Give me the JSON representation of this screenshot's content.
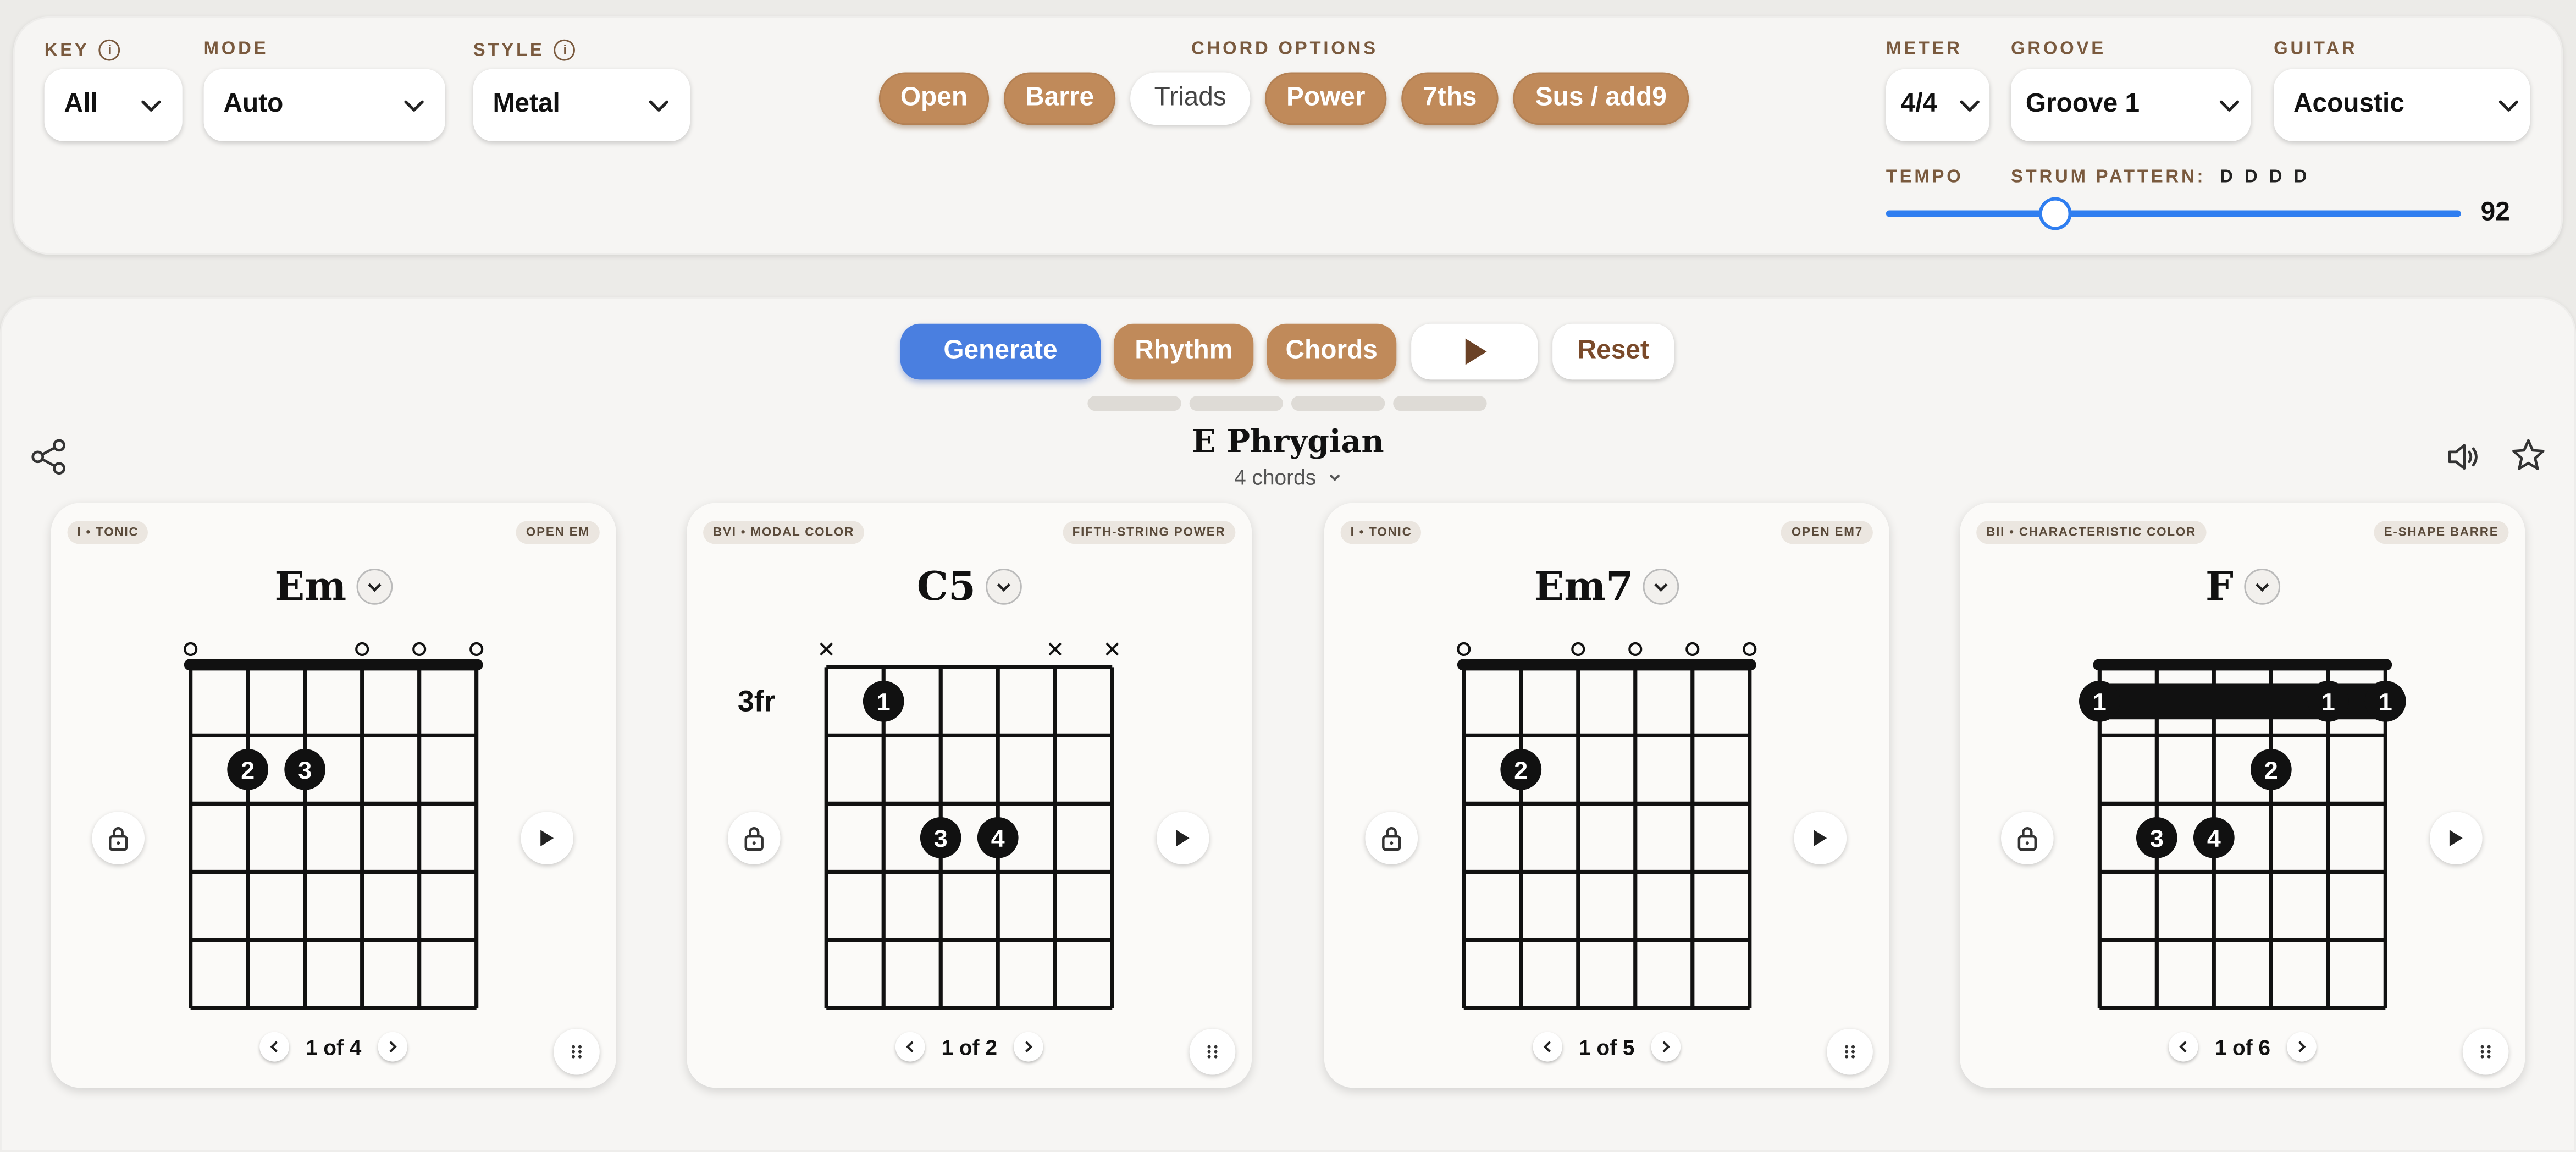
{
  "controls": {
    "key": {
      "label": "KEY",
      "value": "All"
    },
    "mode": {
      "label": "MODE",
      "value": "Auto"
    },
    "style": {
      "label": "STYLE",
      "value": "Metal"
    },
    "chord_options": {
      "label": "CHORD OPTIONS",
      "items": [
        {
          "label": "Open",
          "active": true
        },
        {
          "label": "Barre",
          "active": true
        },
        {
          "label": "Triads",
          "active": false
        },
        {
          "label": "Power",
          "active": true
        },
        {
          "label": "7ths",
          "active": true
        },
        {
          "label": "Sus / add9",
          "active": true
        }
      ]
    },
    "meter": {
      "label": "METER",
      "value": "4/4"
    },
    "groove": {
      "label": "GROOVE",
      "value": "Groove 1"
    },
    "guitar": {
      "label": "GUITAR",
      "value": "Acoustic"
    },
    "tempo": {
      "label": "TEMPO",
      "value": "92",
      "min": 40,
      "max": 220
    },
    "strum": {
      "label": "STRUM PATTERN:",
      "value": "D D D D"
    }
  },
  "actions": {
    "generate": "Generate",
    "rhythm": "Rhythm",
    "chords": "Chords",
    "reset": "Reset",
    "play_icon": "play-icon"
  },
  "progression": {
    "title": "E Phrygian",
    "count": "4 chords"
  },
  "colors": {
    "accent": "#c08a5a",
    "primary": "#4a7fe0",
    "label": "#7a5a3e",
    "background": "#ecebe8"
  },
  "chords": [
    {
      "role": "I • TONIC",
      "shape": "OPEN EM",
      "name": "Em",
      "page": "1 of 4",
      "markers": [
        "o",
        "",
        "",
        "o",
        "o",
        "o"
      ],
      "position": "",
      "nut": true,
      "barres": [],
      "dots": [
        {
          "string": 2,
          "fret": 2,
          "finger": "2"
        },
        {
          "string": 3,
          "fret": 2,
          "finger": "3"
        }
      ]
    },
    {
      "role": "BVI • MODAL COLOR",
      "shape": "FIFTH-STRING POWER",
      "name": "C5",
      "page": "1 of 2",
      "markers": [
        "x",
        "",
        "",
        "",
        "x",
        "x"
      ],
      "position": "3fr",
      "nut": false,
      "barres": [],
      "dots": [
        {
          "string": 2,
          "fret": 1,
          "finger": "1"
        },
        {
          "string": 3,
          "fret": 3,
          "finger": "3"
        },
        {
          "string": 4,
          "fret": 3,
          "finger": "4"
        }
      ]
    },
    {
      "role": "I • TONIC",
      "shape": "OPEN EM7",
      "name": "Em7",
      "page": "1 of 5",
      "markers": [
        "o",
        "",
        "o",
        "o",
        "o",
        "o"
      ],
      "position": "",
      "nut": true,
      "barres": [],
      "dots": [
        {
          "string": 2,
          "fret": 2,
          "finger": "2"
        }
      ]
    },
    {
      "role": "BII • CHARACTERISTIC COLOR",
      "shape": "E-SHAPE BARRE",
      "name": "F",
      "page": "1 of 6",
      "markers": [
        "",
        "",
        "",
        "",
        "",
        ""
      ],
      "position": "",
      "nut": true,
      "barres": [
        {
          "fret": 1,
          "from": 1,
          "to": 6
        }
      ],
      "dots": [
        {
          "string": 1,
          "fret": 1,
          "finger": "1"
        },
        {
          "string": 5,
          "fret": 1,
          "finger": "1"
        },
        {
          "string": 6,
          "fret": 1,
          "finger": "1"
        },
        {
          "string": 4,
          "fret": 2,
          "finger": "2"
        },
        {
          "string": 2,
          "fret": 3,
          "finger": "3"
        },
        {
          "string": 3,
          "fret": 3,
          "finger": "4"
        }
      ]
    }
  ]
}
